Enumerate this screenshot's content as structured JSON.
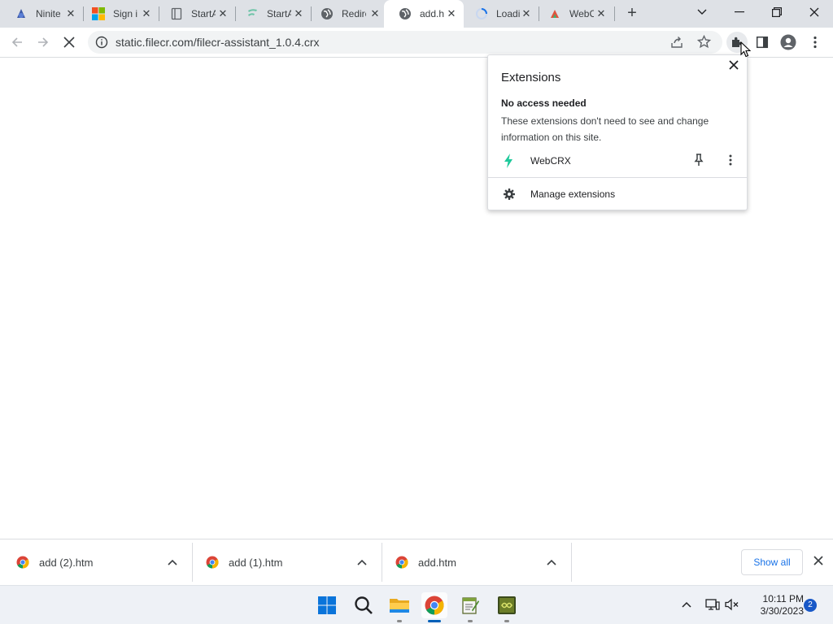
{
  "tabs": [
    {
      "title": "Ninite",
      "icon": "ninite-icon",
      "active": false
    },
    {
      "title": "Sign in",
      "icon": "microsoft-icon",
      "active": false
    },
    {
      "title": "StartAllBack",
      "icon": "document-icon",
      "active": false
    },
    {
      "title": "StartAllBack",
      "icon": "f-logo-icon",
      "active": false
    },
    {
      "title": "Redirect",
      "icon": "globe-icon",
      "active": false
    },
    {
      "title": "add.htm",
      "icon": "globe-icon",
      "active": true
    },
    {
      "title": "Loading",
      "icon": "loading-spinner-icon",
      "active": false
    },
    {
      "title": "WebCRX",
      "icon": "webcrx-icon",
      "active": false
    }
  ],
  "toolbar": {
    "url": "static.filecr.com/filecr-assistant_1.0.4.crx"
  },
  "extensions_popup": {
    "title": "Extensions",
    "section_heading": "No access needed",
    "section_description": "These extensions don't need to see and change information on this site.",
    "extension_name": "WebCRX",
    "manage_label": "Manage extensions"
  },
  "downloads": [
    {
      "name": "add (2).htm"
    },
    {
      "name": "add (1).htm"
    },
    {
      "name": "add.htm"
    }
  ],
  "download_bar": {
    "show_all_label": "Show all"
  },
  "taskbar": {
    "time": "10:11 PM",
    "date": "3/30/2023",
    "notification_count": "2"
  },
  "colors": {
    "tabstrip_bg": "#dee1e6",
    "accent_blue": "#1a73e8",
    "webcrx_green": "#1ec99b"
  }
}
